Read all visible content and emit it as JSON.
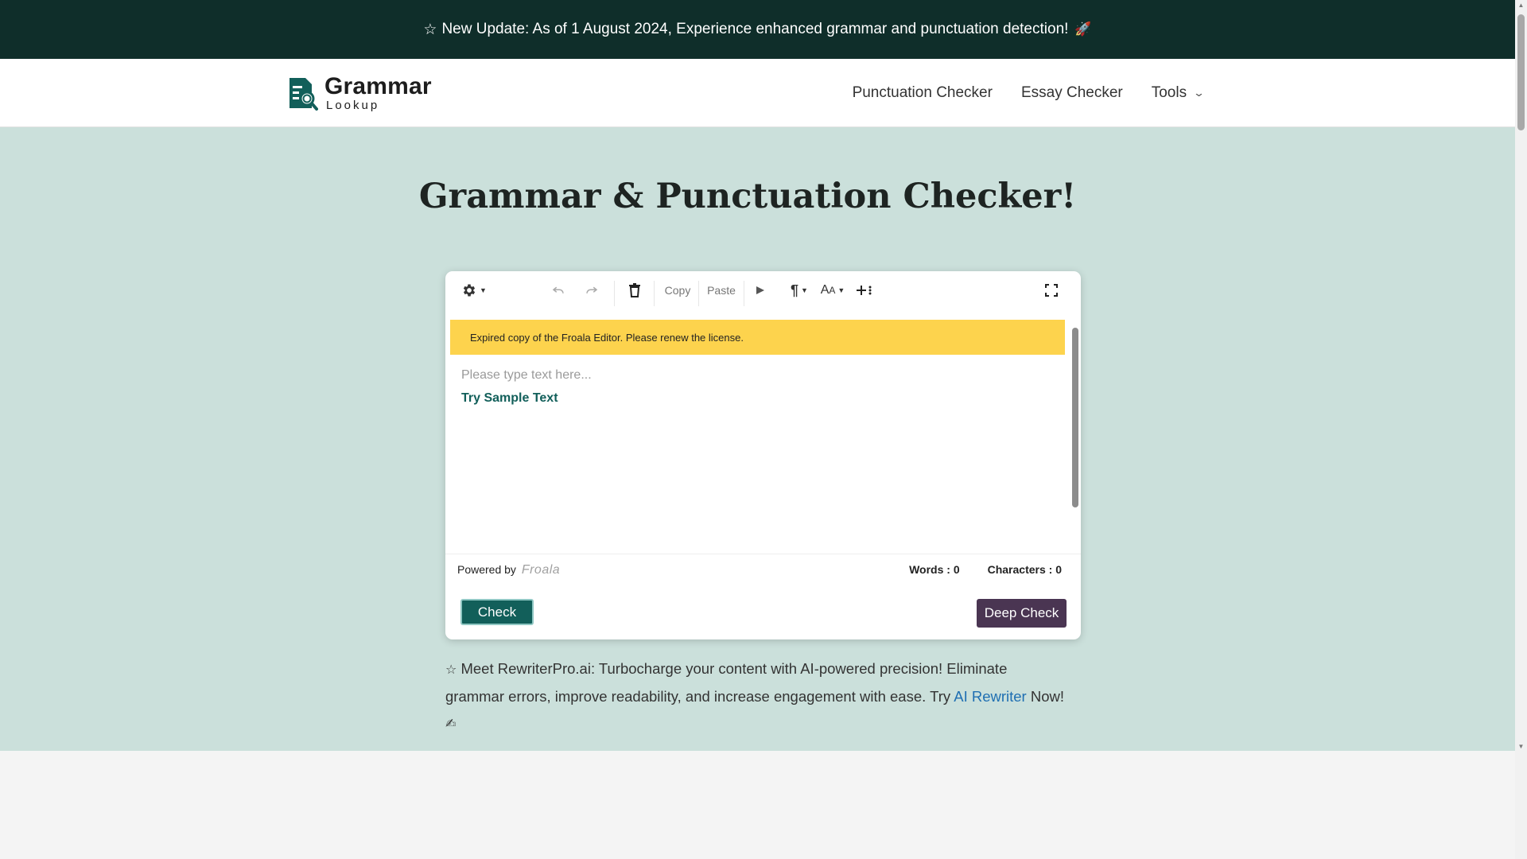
{
  "banner": {
    "star": "☆",
    "text": "New Update: As of 1 August 2024, Experience enhanced grammar and punctuation detection!",
    "rocket": "🚀"
  },
  "logo": {
    "title": "Grammar",
    "subtitle": "Lookup"
  },
  "nav": {
    "items": [
      {
        "label": "Punctuation Checker"
      },
      {
        "label": "Essay Checker"
      },
      {
        "label": "Tools"
      }
    ]
  },
  "main": {
    "title": "Grammar & Punctuation Checker!"
  },
  "editor": {
    "toolbar": {
      "copy_label": "Copy",
      "paste_label": "Paste"
    },
    "license_notice": "Expired copy of the Froala Editor. Please renew the license.",
    "placeholder": "Please type text here...",
    "sample_link": "Try Sample Text",
    "powered_by": "Powered by",
    "powered_brand": "Froala",
    "words_label": "Words : 0",
    "chars_label": "Characters : 0",
    "check_label": "Check",
    "deep_check_label": "Deep Check"
  },
  "promo": {
    "star": "☆",
    "text": "Meet RewriterPro.ai: Turbocharge your content with AI-powered precision! Eliminate grammar errors, improve readability, and increase engagement with ease. Try",
    "link": "AI Rewriter",
    "tail": "Now!",
    "emoji": "✍"
  },
  "colors": {
    "banner_bg": "#0f2e2a",
    "main_bg": "#cbe0db",
    "accent": "#125f5a",
    "deep_check_bg": "#4a3552",
    "license_bg": "#fdd34d",
    "link": "#1f6fb2"
  }
}
